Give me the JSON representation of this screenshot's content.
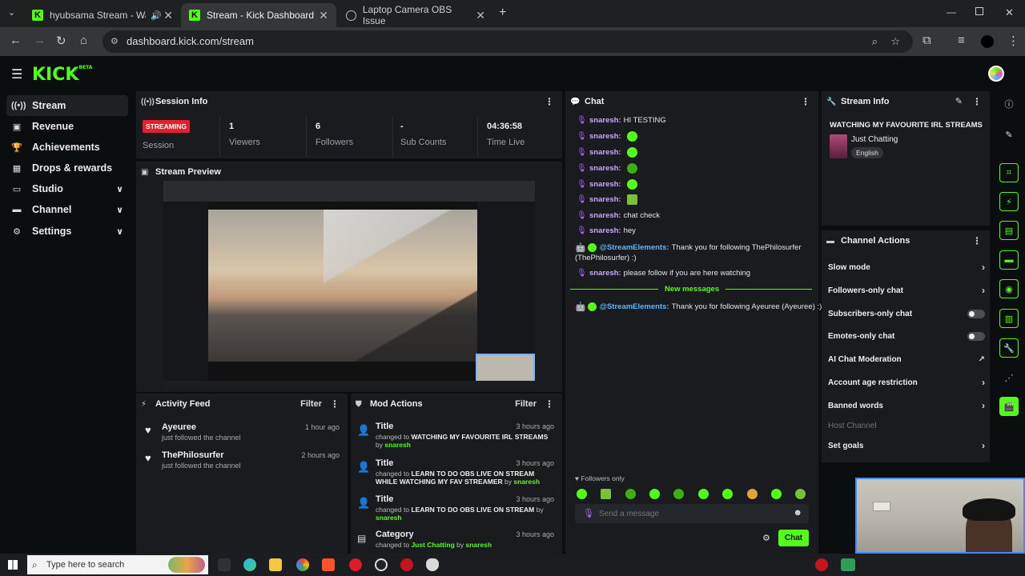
{
  "browser": {
    "tabs": [
      {
        "title": "hyubsama Stream - Watch Live o",
        "favicon": "kick"
      },
      {
        "title": "Stream - Kick Dashboard",
        "favicon": "kick"
      },
      {
        "title": "Laptop Camera OBS Issue",
        "favicon": "globe"
      }
    ],
    "url": "dashboard.kick.com/stream"
  },
  "kick": {
    "logo": "KICK",
    "logo_badge": "BETA",
    "accent": "#53fc18"
  },
  "sidebar": {
    "items": [
      {
        "label": "Stream",
        "icon": "broadcast-icon"
      },
      {
        "label": "Revenue",
        "icon": "revenue-icon"
      },
      {
        "label": "Achievements",
        "icon": "trophy-icon"
      },
      {
        "label": "Drops & rewards",
        "icon": "gift-icon"
      },
      {
        "label": "Studio",
        "icon": "studio-icon"
      },
      {
        "label": "Channel",
        "icon": "channel-icon"
      },
      {
        "label": "Settings",
        "icon": "gear-icon"
      }
    ]
  },
  "session": {
    "title": "Session Info",
    "badge": "STREAMING",
    "session_label": "Session",
    "viewers_value": "1",
    "viewers_label": "Viewers",
    "followers_value": "6",
    "followers_label": "Followers",
    "subs_value": "-",
    "subs_label": "Sub Counts",
    "time_value": "04:36:58",
    "time_label": "Time Live"
  },
  "preview": {
    "title": "Stream Preview"
  },
  "activity": {
    "title": "Activity Feed",
    "filter": "Filter",
    "items": [
      {
        "name": "Ayeuree",
        "sub": "just followed the channel",
        "time": "1 hour ago"
      },
      {
        "name": "ThePhilosurfer",
        "sub": "just followed the channel",
        "time": "2 hours ago"
      }
    ]
  },
  "mod": {
    "title": "Mod Actions",
    "filter": "Filter",
    "items": [
      {
        "kind": "Title",
        "time": "3 hours ago",
        "pre": "changed to",
        "value": "WATCHING MY FAVOURITE IRL STREAMS",
        "by": "by",
        "user": "snaresh"
      },
      {
        "kind": "Title",
        "time": "3 hours ago",
        "pre": "changed to",
        "value": "LEARN TO DO OBS LIVE ON STREAM WHILE WATCHING MY FAV STREAMER",
        "by": "by",
        "user": "snaresh"
      },
      {
        "kind": "Title",
        "time": "3 hours ago",
        "pre": "changed to",
        "value": "LEARN TO DO OBS LIVE ON STREAM",
        "by": "by",
        "user": "snaresh"
      },
      {
        "kind": "Category",
        "time": "3 hours ago",
        "pre": "changed to",
        "value": "Just Chatting",
        "by": "by",
        "user": "snaresh"
      }
    ]
  },
  "chat": {
    "title": "Chat",
    "messages": [
      {
        "user": "snaresh:",
        "text": "HI TESTING",
        "emote": false
      },
      {
        "user": "snaresh:",
        "text": "",
        "emote": true
      },
      {
        "user": "snaresh:",
        "text": "",
        "emote": true
      },
      {
        "user": "snaresh:",
        "text": "",
        "emote": true
      },
      {
        "user": "snaresh:",
        "text": "",
        "emote": true
      },
      {
        "user": "snaresh:",
        "text": "",
        "emote": true
      },
      {
        "user": "snaresh:",
        "text": "chat check",
        "emote": false
      },
      {
        "user": "snaresh:",
        "text": "hey",
        "emote": false
      }
    ],
    "bot1_user": "@StreamElements:",
    "bot1_text": "Thank you for following ThePhilosurfer",
    "bot1_text2": "(ThePhilosurfer) :)",
    "last_user": "snaresh:",
    "last_text": "please follow if you are here watching",
    "new_messages": "New messages",
    "bot2_user": "@StreamElements:",
    "bot2_text": "Thank you for following Ayeuree (Ayeuree) :)",
    "followers_only": "Followers only",
    "input_placeholder": "Send a message",
    "send_label": "Chat"
  },
  "stream_info": {
    "title": "Stream Info",
    "stream_title": "WATCHING MY FAVOURITE IRL STREAMS",
    "category": "Just Chatting",
    "language": "English"
  },
  "channel_actions": {
    "title": "Channel Actions",
    "items": [
      {
        "label": "Slow mode",
        "control": "chevron"
      },
      {
        "label": "Followers-only chat",
        "control": "chevron"
      },
      {
        "label": "Subscribers-only chat",
        "control": "toggle"
      },
      {
        "label": "Emotes-only chat",
        "control": "toggle"
      },
      {
        "label": "AI Chat Moderation",
        "control": "external"
      },
      {
        "label": "Account age restriction",
        "control": "chevron"
      },
      {
        "label": "Banned words",
        "control": "chevron"
      },
      {
        "label": "Host Channel",
        "control": "none"
      },
      {
        "label": "Set goals",
        "control": "chevron"
      }
    ]
  },
  "taskbar": {
    "search_placeholder": "Type here to search"
  }
}
